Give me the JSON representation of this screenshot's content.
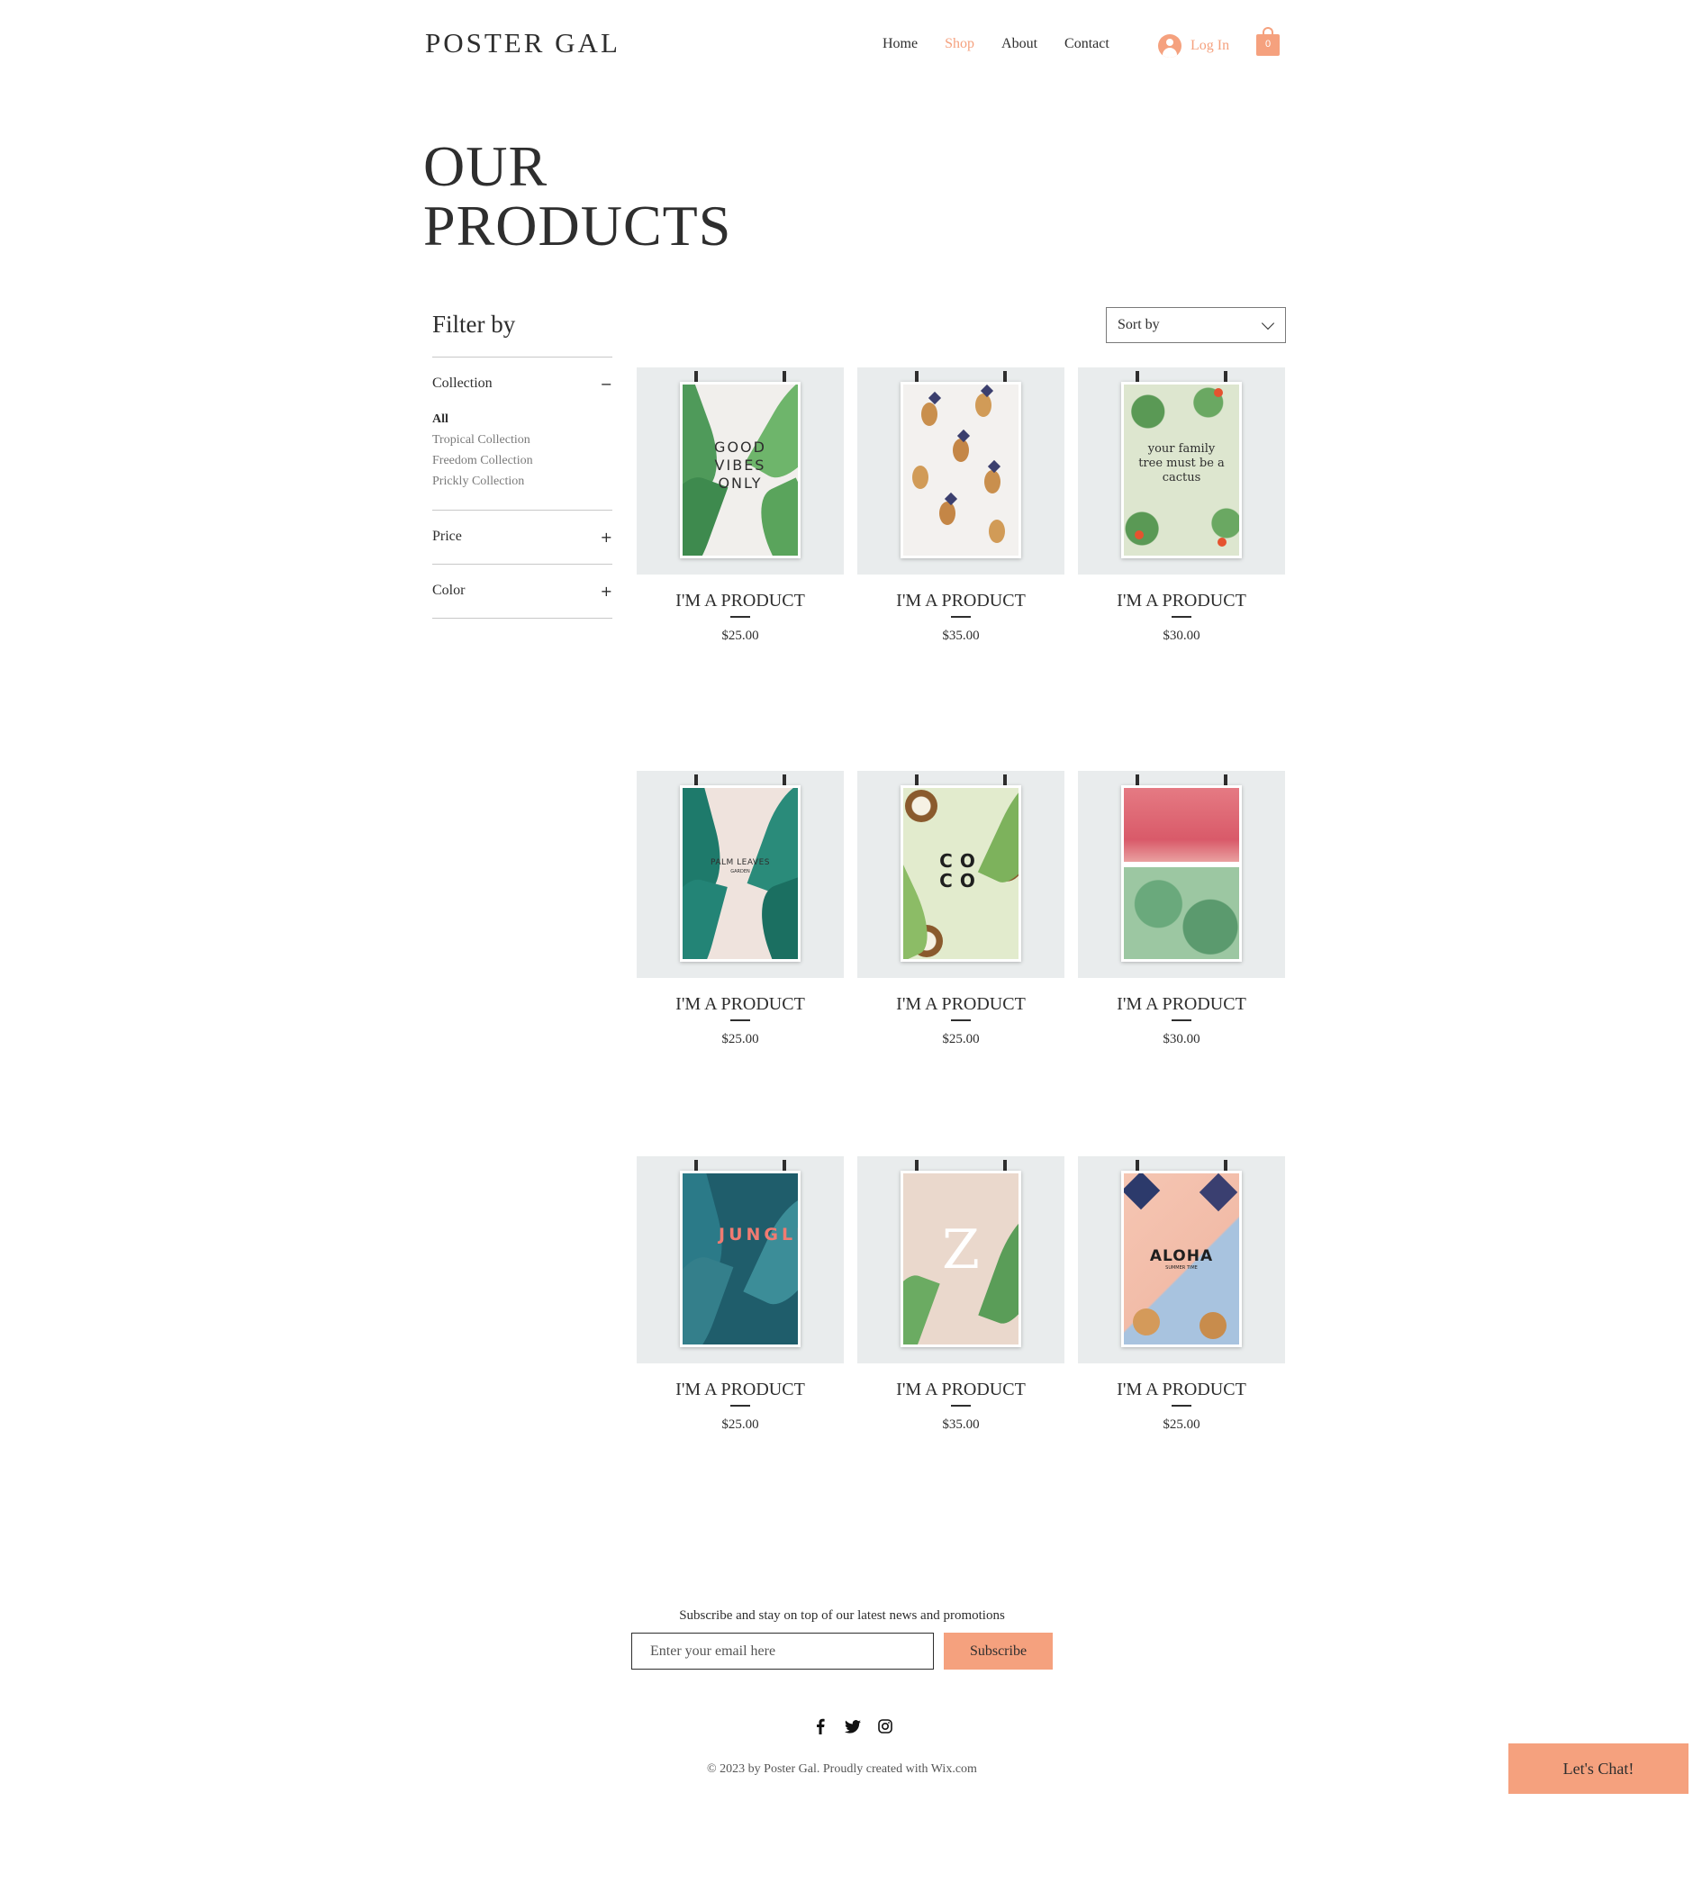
{
  "header": {
    "logo": "POSTER GAL",
    "nav": [
      "Home",
      "Shop",
      "About",
      "Contact"
    ],
    "active_nav": "Shop",
    "login_label": "Log In",
    "cart_count": "0",
    "accent_color": "#f5a17e"
  },
  "page": {
    "title_line1": "OUR",
    "title_line2": "PRODUCTS"
  },
  "filter": {
    "title": "Filter by",
    "collection_label": "Collection",
    "collection_toggle": "−",
    "collections": [
      "All",
      "Tropical Collection",
      "Freedom Collection",
      "Prickly Collection"
    ],
    "selected_collection": "All",
    "price_label": "Price",
    "price_toggle": "+",
    "color_label": "Color",
    "color_toggle": "+"
  },
  "sort": {
    "label": "Sort by"
  },
  "products": [
    {
      "name": "I'M A PRODUCT",
      "price": "$25.00",
      "poster_text": "GOOD VIBES ONLY",
      "art": "palm-leaves-marble"
    },
    {
      "name": "I'M A PRODUCT",
      "price": "$35.00",
      "poster_text": "",
      "art": "pineapples-marble"
    },
    {
      "name": "I'M A PRODUCT",
      "price": "$30.00",
      "poster_text": "your family tree must be a cactus",
      "art": "cactus"
    },
    {
      "name": "I'M A PRODUCT",
      "price": "$25.00",
      "poster_text": "PALM LEAVES",
      "poster_subtext": "GARDEN",
      "art": "monstera-pink"
    },
    {
      "name": "I'M A PRODUCT",
      "price": "$25.00",
      "poster_text": "CO CO",
      "art": "coconuts"
    },
    {
      "name": "I'M A PRODUCT",
      "price": "$30.00",
      "poster_text": "",
      "art": "watermelon-monstera"
    },
    {
      "name": "I'M A PRODUCT",
      "price": "$25.00",
      "poster_text": "JUNGLE",
      "art": "jungle-teal"
    },
    {
      "name": "I'M A PRODUCT",
      "price": "$35.00",
      "poster_text": "Z",
      "art": "z-island"
    },
    {
      "name": "I'M A PRODUCT",
      "price": "$25.00",
      "poster_text": "ALOHA",
      "poster_subtext": "SUMMER TIME",
      "art": "aloha-pineapples"
    }
  ],
  "footer": {
    "subscribe_text": "Subscribe and stay on top of our latest news and promotions",
    "email_placeholder": "Enter your email here",
    "subscribe_button": "Subscribe",
    "social_icons": [
      "facebook-icon",
      "twitter-icon",
      "instagram-icon"
    ],
    "copyright": "© 2023 by Poster Gal. Proudly created with Wix.com",
    "chat_button": "Let's Chat!"
  }
}
